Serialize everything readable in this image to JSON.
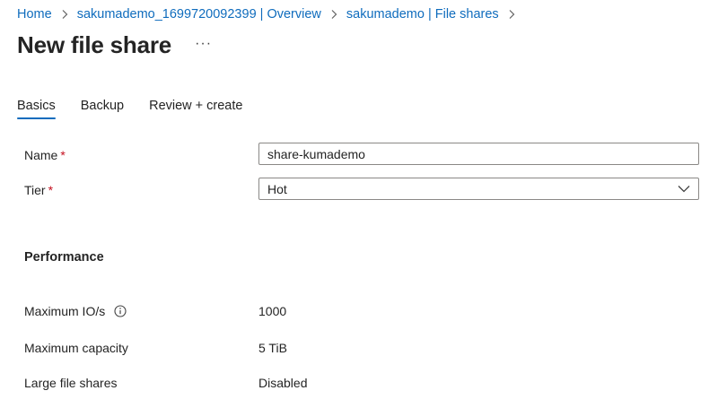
{
  "breadcrumb": {
    "items": [
      {
        "label": "Home"
      },
      {
        "label": "sakumademo_1699720092399 | Overview"
      },
      {
        "label": "sakumademo | File shares"
      }
    ]
  },
  "header": {
    "title": "New file share",
    "more_label": "···"
  },
  "tabs": [
    {
      "label": "Basics",
      "active": true
    },
    {
      "label": "Backup",
      "active": false
    },
    {
      "label": "Review + create",
      "active": false
    }
  ],
  "form": {
    "name": {
      "label": "Name",
      "required_mark": "*",
      "value": "share-kumademo"
    },
    "tier": {
      "label": "Tier",
      "required_mark": "*",
      "value": "Hot"
    }
  },
  "performance": {
    "heading": "Performance",
    "rows": [
      {
        "label": "Maximum IO/s",
        "value": "1000",
        "info_icon": "info-icon"
      },
      {
        "label": "Maximum capacity",
        "value": "5 TiB"
      },
      {
        "label": "Large file shares",
        "value": "Disabled"
      }
    ]
  },
  "colors": {
    "accent": "#0f6cbd",
    "required": "#c50f1f",
    "text": "#242424",
    "border": "#8a8886"
  }
}
